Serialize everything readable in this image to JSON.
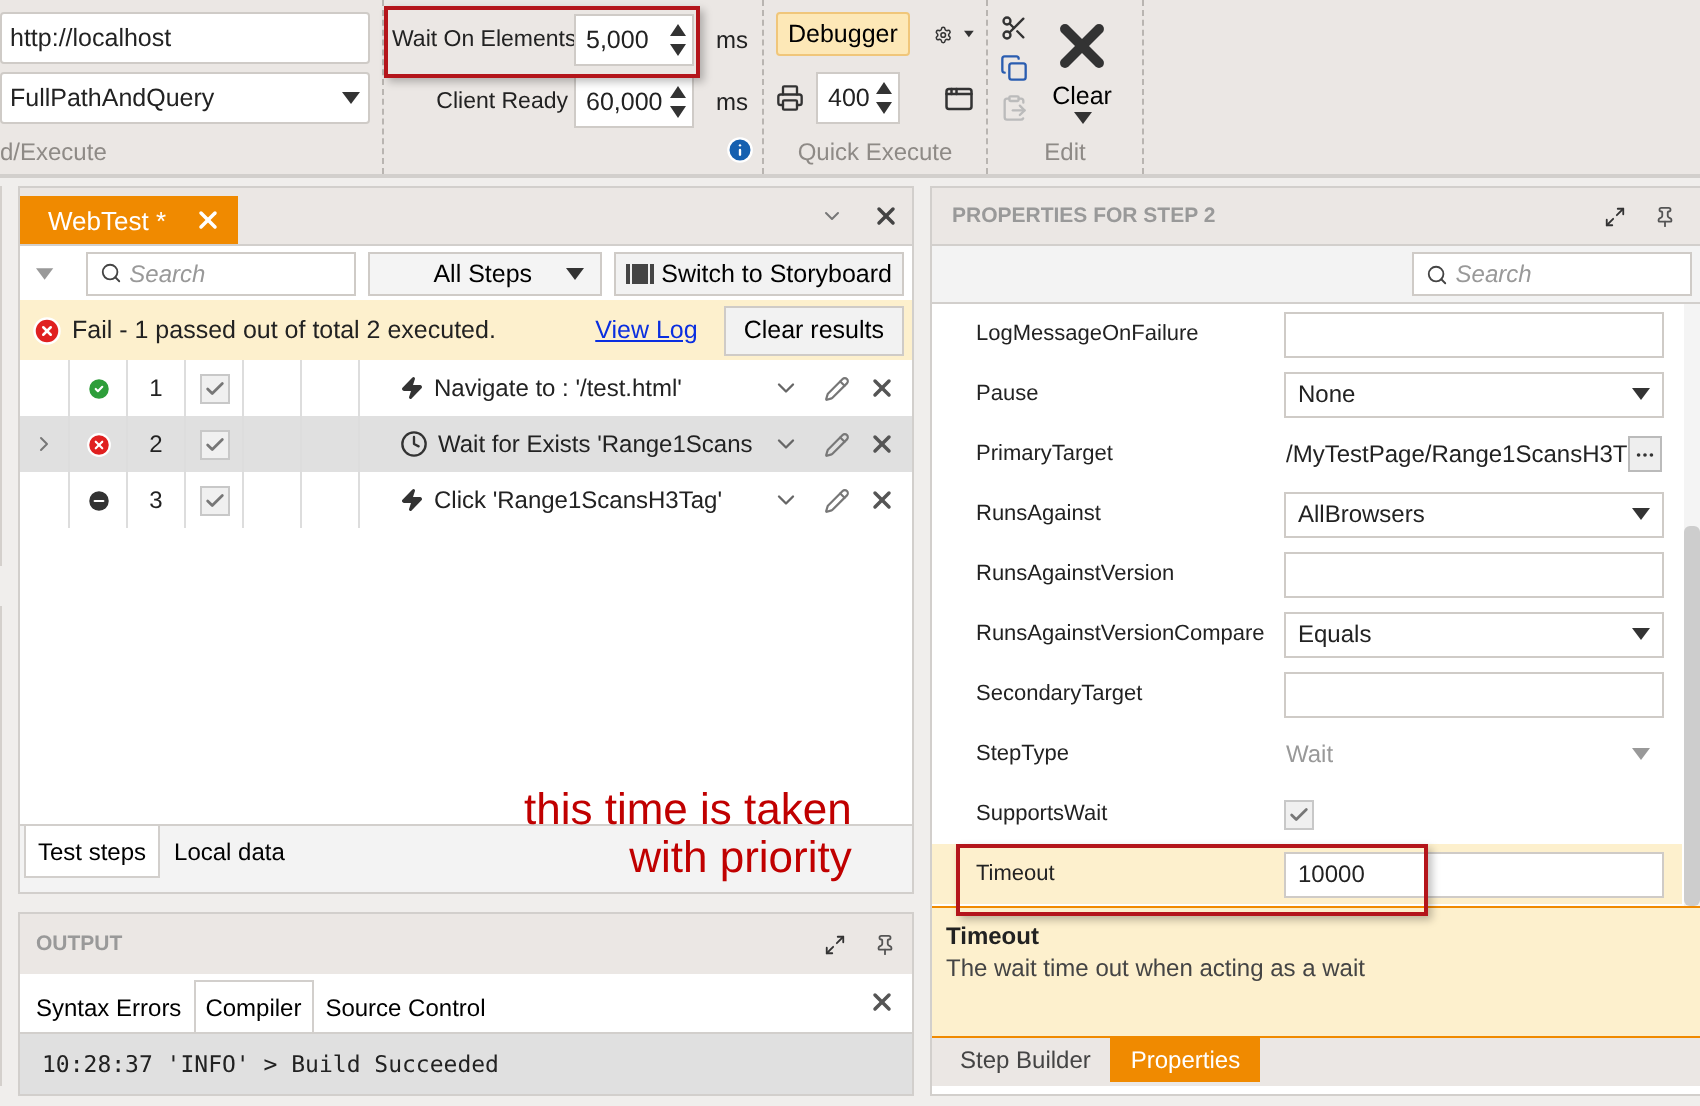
{
  "ribbon": {
    "url_field": {
      "value": "http://localhost"
    },
    "url_mode": {
      "value": "FullPathAndQuery"
    },
    "load_group_label": "d/Execute",
    "timings": [
      {
        "label": "Wait On Elements",
        "value": "5,000",
        "unit": "ms",
        "highlighted": true
      },
      {
        "label": "Client Ready",
        "value": "60,000",
        "unit": "ms",
        "highlighted": false
      }
    ],
    "quick_execute": {
      "debugger": "Debugger",
      "count": "400",
      "label": "Quick Execute"
    },
    "edit": {
      "clear": "Clear",
      "label": "Edit",
      "paste_disabled": true
    }
  },
  "test_panel": {
    "tab": {
      "label": "WebTest *",
      "selected": true
    },
    "search": {
      "placeholder": "Search"
    },
    "filter": "All Steps",
    "storyboard_button": "Switch to Storyboard",
    "result": {
      "kind": "fail",
      "message": "Fail - 1 passed out of total 2 executed.",
      "link": "View Log",
      "button": "Clear results"
    },
    "steps": [
      {
        "status": {
          "kind": "pass"
        },
        "number": "1",
        "checked": true,
        "kind": "action",
        "text": "Navigate to : '/test.html'",
        "selected": false
      },
      {
        "status": {
          "kind": "fail"
        },
        "number": "2",
        "checked": true,
        "kind": "wait",
        "text": "Wait for Exists 'Range1Scans",
        "selected": true
      },
      {
        "status": {
          "kind": "skipped"
        },
        "number": "3",
        "checked": true,
        "kind": "action",
        "text": "Click 'Range1ScansH3Tag'",
        "selected": false
      }
    ],
    "bottom_tabs": [
      {
        "label": "Test steps",
        "selected": true
      },
      {
        "label": "Local data",
        "selected": false
      }
    ]
  },
  "output": {
    "title": "OUTPUT",
    "tabs": [
      {
        "label": "Syntax Errors",
        "selected": false
      },
      {
        "label": "Compiler",
        "selected": true
      },
      {
        "label": "Source Control",
        "selected": false
      }
    ],
    "lines": [
      "10:28:37 'INFO' > Build Succeeded"
    ]
  },
  "properties": {
    "title": "PROPERTIES FOR STEP 2",
    "search": {
      "placeholder": "Search"
    },
    "rows": [
      {
        "kind": "text",
        "label": "LogMessageOnFailure",
        "value": "",
        "selected": false
      },
      {
        "kind": "dropdown",
        "label": "Pause",
        "value": "None",
        "selected": false
      },
      {
        "kind": "browse",
        "label": "PrimaryTarget",
        "value": "/MyTestPage/Range1ScansH3T",
        "selected": false
      },
      {
        "kind": "dropdown",
        "label": "RunsAgainst",
        "value": "AllBrowsers",
        "selected": false
      },
      {
        "kind": "text",
        "label": "RunsAgainstVersion",
        "value": "",
        "selected": false
      },
      {
        "kind": "dropdown",
        "label": "RunsAgainstVersionCompare",
        "value": "Equals",
        "selected": false
      },
      {
        "kind": "text",
        "label": "SecondaryTarget",
        "value": "",
        "selected": false
      },
      {
        "kind": "readonly",
        "label": "StepType",
        "value": "Wait",
        "selected": false
      },
      {
        "kind": "checkbox",
        "label": "SupportsWait",
        "checked": true,
        "selected": false
      },
      {
        "kind": "text",
        "label": "Timeout",
        "value": "10000",
        "selected": true,
        "highlighted": true
      }
    ],
    "description": {
      "title": "Timeout",
      "text": "The wait time out when acting as a wait"
    },
    "tabs": [
      {
        "label": "Step Builder",
        "selected": false
      },
      {
        "label": "Properties",
        "selected": true
      }
    ]
  },
  "annotation": {
    "note": "this time is taken\nwith priority"
  }
}
